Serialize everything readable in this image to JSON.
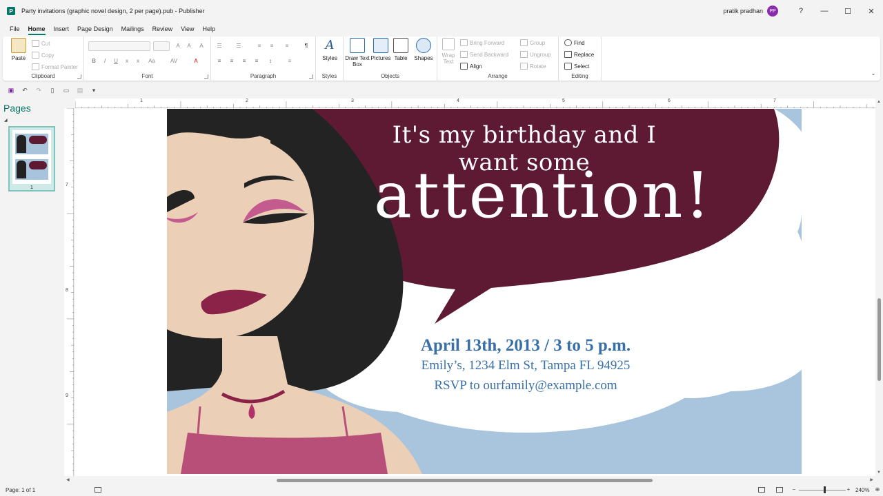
{
  "window": {
    "app_icon": "P",
    "title": "Party invitations (graphic novel design, 2 per page).pub  -  Publisher",
    "user_name": "pratik pradhan",
    "user_initials": "PP",
    "help": "?",
    "minimize": "—",
    "maximize": "☐",
    "close": "✕"
  },
  "menu": {
    "tabs": [
      "File",
      "Home",
      "Insert",
      "Page Design",
      "Mailings",
      "Review",
      "View",
      "Help"
    ],
    "active": "Home"
  },
  "ribbon": {
    "clipboard": {
      "label": "Clipboard",
      "paste": "Paste",
      "cut": "Cut",
      "copy": "Copy",
      "format_painter": "Format Painter"
    },
    "font": {
      "label": "Font"
    },
    "paragraph": {
      "label": "Paragraph"
    },
    "styles": {
      "label": "Styles",
      "button": "Styles"
    },
    "objects": {
      "label": "Objects",
      "draw_text_box": "Draw Text Box",
      "pictures": "Pictures",
      "table": "Table",
      "shapes": "Shapes"
    },
    "arrange": {
      "label": "Arrange",
      "wrap_text": "Wrap Text",
      "bring_forward": "Bring Forward",
      "send_backward": "Send Backward",
      "align": "Align",
      "group": "Group",
      "ungroup": "Ungroup",
      "rotate": "Rotate"
    },
    "editing": {
      "label": "Editing",
      "find": "Find",
      "replace": "Replace",
      "select": "Select"
    }
  },
  "pages_panel": {
    "title": "Pages",
    "page_number": "1"
  },
  "rulers": {
    "top": [
      "1",
      "2",
      "3",
      "4",
      "5",
      "6",
      "7"
    ],
    "left": [
      "7",
      "8",
      "9"
    ]
  },
  "invitation": {
    "line1": "It's my birthday and I want some",
    "line2": "attention!",
    "date": "April 13th, 2013 / 3 to 5 p.m.",
    "address": "Emily’s, 1234 Elm St, Tampa FL 94925",
    "rsvp": "RSVP to ourfamily@example.com",
    "colors": {
      "bubble": "#5e1a33",
      "sky": "#a9c4dd",
      "skin": "#ebcfb6",
      "hair": "#232323",
      "lips": "#8a2347",
      "text": "#3a70a7"
    }
  },
  "status": {
    "page": "Page: 1 of 1",
    "zoom": "240%"
  }
}
